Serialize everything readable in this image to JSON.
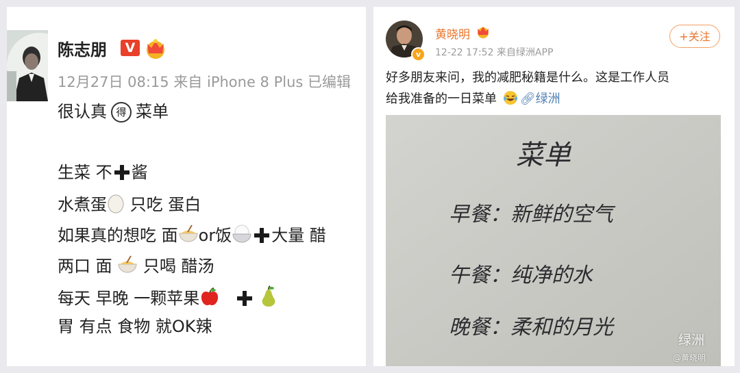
{
  "left_post": {
    "user_name": "陈志朋",
    "verified_badge": "V",
    "meta": "12月27日 08:15 来自 iPhone 8 Plus   已编辑",
    "lines": {
      "l1_a": "很认真",
      "l1_b": "得",
      "l1_c": "菜单",
      "l2_a": "生菜 不",
      "l2_b": "酱",
      "l3_a": "水煮蛋",
      "l3_b": " 只吃 蛋白",
      "l4_a": "如果真的想吃 面",
      "l4_b": "or饭",
      "l4_c": "大量 醋",
      "l5_a": "两口 面 ",
      "l5_b": " 只喝 醋汤",
      "l6_a": "每天 早晚 一颗苹果",
      "l6_b": "",
      "l7": "胃 有点 食物 就OK辣"
    }
  },
  "right_post": {
    "user_name": "黄晓明",
    "meta": "12-22 17:52  来自绿洲APP",
    "follow_label": "+关注",
    "text_line1": "好多朋友来问，我的减肥秘籍是什么。这是工作人员",
    "text_line2": "给我准备的一日菜单",
    "link_label": "绿洲",
    "photo": {
      "title": "菜单",
      "breakfast": "早餐：新鲜的空气",
      "lunch": "午餐：纯净的水",
      "dinner": "晚餐：柔和的月光",
      "watermark": "绿洲",
      "watermark_user": "@黄晓明"
    }
  },
  "colors": {
    "accent_orange": "#e8762d",
    "link_blue": "#4f7fb0",
    "verified_red": "#e8402a",
    "meta_gray": "#9a9a9a"
  },
  "icons": [
    "crown-icon",
    "verified-icon",
    "egg-icon",
    "noodle-bowl-icon",
    "rice-bowl-icon",
    "plus-icon",
    "apple-icon",
    "pear-icon",
    "laugh-cry-icon",
    "link-icon"
  ]
}
